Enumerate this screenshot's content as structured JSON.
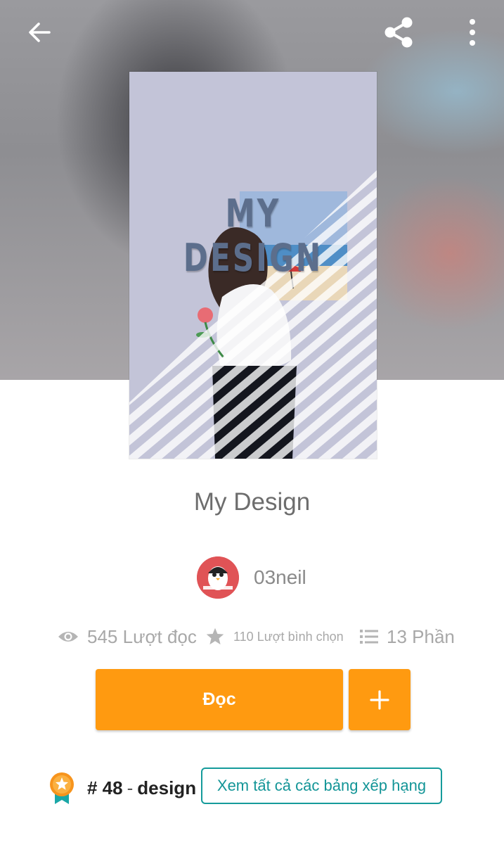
{
  "cover": {
    "title": "MY DESIGN"
  },
  "book": {
    "title": "My Design"
  },
  "author": {
    "name": "03neil",
    "avatar_text": "03neil"
  },
  "stats": {
    "reads": "545 Lượt đọc",
    "votes": "110 Lượt bình chọn",
    "parts": "13 Phần"
  },
  "actions": {
    "read_label": "Đọc"
  },
  "ranking": {
    "number": "# 48",
    "separator": "-",
    "tag": "design",
    "view_all_label": "Xem tất cả các bảng xếp hạng"
  },
  "icons": [
    "back-arrow-icon",
    "share-icon",
    "more-vertical-icon",
    "eye-icon",
    "star-icon",
    "list-icon",
    "plus-icon",
    "medal-icon"
  ],
  "colors": {
    "accent": "#ff9a10",
    "teal": "#139597",
    "muted": "#a8a8a8"
  }
}
